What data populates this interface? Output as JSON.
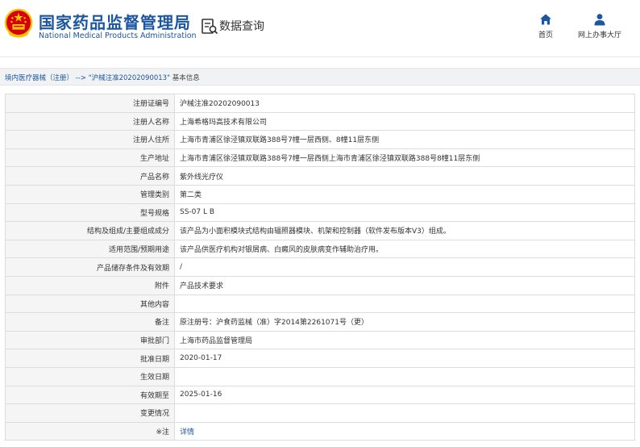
{
  "header": {
    "org_name_cn": "国家药品监督管理局",
    "org_name_en": "National Medical Products Administration",
    "section_title": "数据查询",
    "nav": {
      "home_label": "首页",
      "office_label": "网上办事大厅"
    }
  },
  "breadcrumb": {
    "category": "境内医疗器械（注册）",
    "separator": "-->",
    "record": "\"沪械注准20202090013\"",
    "current": "基本信息"
  },
  "details": {
    "rows": [
      {
        "label": "注册证编号",
        "value": "沪械注准20202090013"
      },
      {
        "label": "注册人名称",
        "value": "上海希格玛高技术有限公司"
      },
      {
        "label": "注册人住所",
        "value": "上海市青浦区徐泾镇双联路388号7幢一层西侧、8幢11层东侧"
      },
      {
        "label": "生产地址",
        "value": "上海市青浦区徐泾镇双联路388号7幢一层西侧上海市青浦区徐泾镇双联路388号8幢11层东侧"
      },
      {
        "label": "产品名称",
        "value": "紫外线光疗仪"
      },
      {
        "label": "管理类别",
        "value": "第二类"
      },
      {
        "label": "型号规格",
        "value": "SS-07 L B"
      },
      {
        "label": "结构及组成/主要组成成分",
        "value": "该产品为小面积模块式结构由辐照器模块、机架和控制器（软件发布版本V3）组成。"
      },
      {
        "label": "适用范围/预期用途",
        "value": "该产品供医疗机构对银屑病、白癜风的皮肤病变作辅助治疗用。"
      },
      {
        "label": "产品储存条件及有效期",
        "value": "/"
      },
      {
        "label": "附件",
        "value": "产品技术要求"
      },
      {
        "label": "其他内容",
        "value": ""
      },
      {
        "label": "备注",
        "value": "原注册号：沪食药监械（准）字2014第2261071号（更）"
      },
      {
        "label": "审批部门",
        "value": "上海市药品监督管理局"
      },
      {
        "label": "批准日期",
        "value": "2020-01-17"
      },
      {
        "label": "生效日期",
        "value": ""
      },
      {
        "label": "有效期至",
        "value": "2025-01-16"
      },
      {
        "label": "变更情况",
        "value": ""
      },
      {
        "label": "※注",
        "value": "详情"
      }
    ]
  },
  "colors": {
    "brand_blue": "#1d56a0",
    "emblem_red": "#d7000f",
    "emblem_gold": "#f5c400"
  },
  "icons": [
    "national-emblem-icon",
    "data-query-icon",
    "home-icon",
    "user-icon"
  ]
}
